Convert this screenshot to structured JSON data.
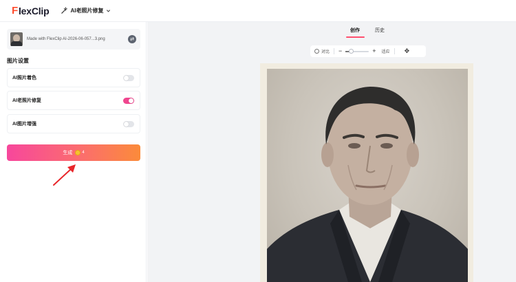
{
  "header": {
    "logo_f": "F",
    "logo_rest": "lexClip",
    "tool_label": "AI老照片修复"
  },
  "left_panel": {
    "file_name": "Made with FlexClip AI-2026-06-057...3.png",
    "section_title": "图片设置",
    "options": [
      {
        "label": "AI照片着色",
        "enabled": false
      },
      {
        "label": "AI老照片修复",
        "enabled": true
      },
      {
        "label": "AI图片增强",
        "enabled": false
      }
    ],
    "generate_label": "生成",
    "generate_cost": "4"
  },
  "right_panel": {
    "tabs": [
      {
        "label": "创作",
        "active": true
      },
      {
        "label": "历史",
        "active": false
      }
    ],
    "toolbar": {
      "compare_label": "对比",
      "minus": "−",
      "plus": "+",
      "fit_label": "适应",
      "zoom_level": 0.2
    }
  },
  "colors": {
    "accent": "#ff4f6e",
    "toggle_on": "#f0468f",
    "generate_gradient_start": "#f7479c",
    "generate_gradient_end": "#fb8b3a",
    "annotation_arrow": "#e8262a"
  },
  "icons": {
    "wand": "magic-wand-icon",
    "chevron": "chevron-down-icon",
    "swap": "swap-icon",
    "compare": "compare-icon",
    "move": "move-arrows-icon",
    "coin": "coin-icon"
  }
}
